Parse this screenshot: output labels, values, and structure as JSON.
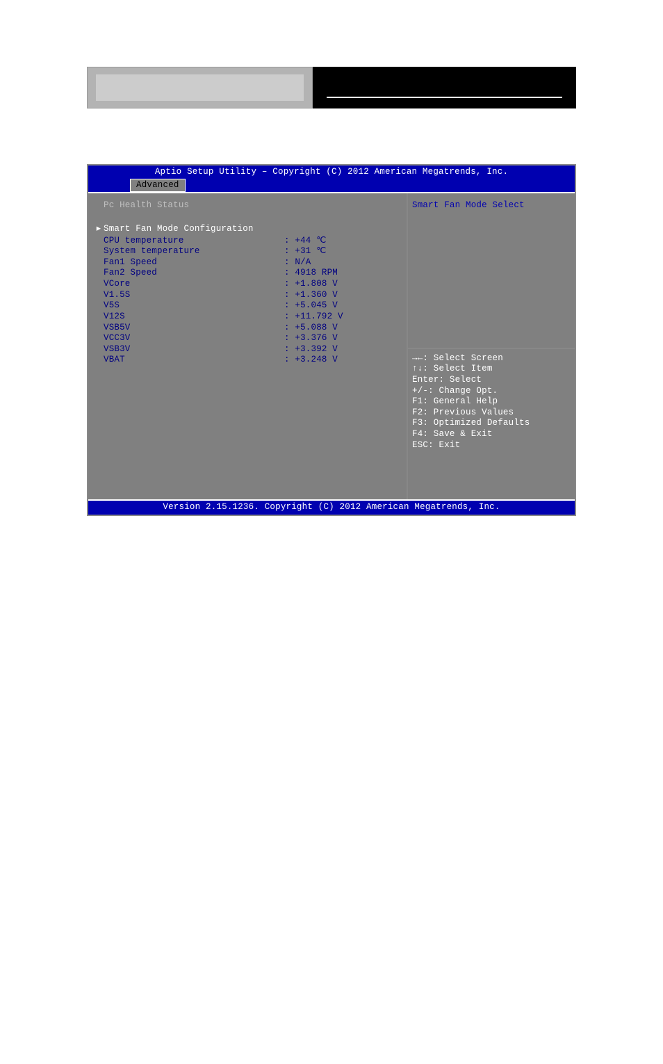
{
  "header": {},
  "bios": {
    "titlebar": "Aptio Setup Utility – Copyright (C) 2012 American Megatrends, Inc.",
    "tab": "Advanced",
    "section_title": "Pc Health Status",
    "submenu": "Smart Fan Mode Configuration",
    "rows": [
      {
        "label": "CPU temperature",
        "value": ": +44 ℃"
      },
      {
        "label": "System temperature",
        "value": ": +31 ℃"
      },
      {
        "label": "Fan1 Speed",
        "value": ": N/A"
      },
      {
        "label": "Fan2 Speed",
        "value": ": 4918 RPM"
      },
      {
        "label": "VCore",
        "value": ": +1.808 V"
      },
      {
        "label": "V1.5S",
        "value": ": +1.360 V"
      },
      {
        "label": "V5S",
        "value": ": +5.045 V"
      },
      {
        "label": "V12S",
        "value": ": +11.792 V"
      },
      {
        "label": "VSB5V",
        "value": ": +5.088 V"
      },
      {
        "label": "VCC3V",
        "value": ": +3.376 V"
      },
      {
        "label": "VSB3V",
        "value": ": +3.392 V"
      },
      {
        "label": "VBAT",
        "value": ": +3.248 V"
      }
    ],
    "help_title": "Smart Fan Mode Select",
    "help_keys": [
      "→←: Select Screen",
      "↑↓: Select Item",
      "Enter: Select",
      "+/-: Change Opt.",
      "F1: General Help",
      "F2: Previous Values",
      "F3: Optimized Defaults",
      "F4: Save & Exit",
      "ESC: Exit"
    ],
    "footer": "Version 2.15.1236. Copyright (C) 2012 American Megatrends, Inc."
  }
}
